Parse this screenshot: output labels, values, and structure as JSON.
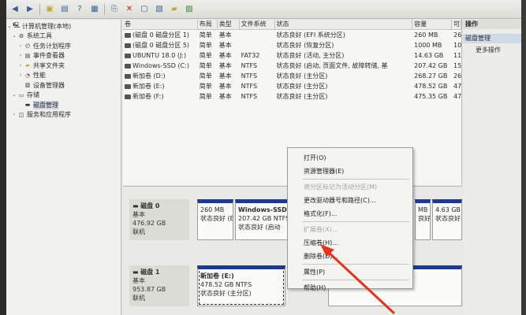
{
  "toolbar": {
    "buttons": [
      "back-icon",
      "forward-icon",
      "up-folder-icon",
      "properties-icon",
      "help-icon",
      "view-icon",
      "connect-icon",
      "delete-icon",
      "new-icon",
      "open-icon",
      "folder-icon",
      "settings-icon"
    ]
  },
  "tree": {
    "items": [
      {
        "label": "计算机管理(本地)",
        "level": 0,
        "icon": "computer-icon",
        "expander": "⌄"
      },
      {
        "label": "系统工具",
        "level": 1,
        "icon": "tools-icon",
        "expander": "⌄"
      },
      {
        "label": "任务计划程序",
        "level": 2,
        "icon": "task-icon",
        "expander": "›"
      },
      {
        "label": "事件查看器",
        "level": 2,
        "icon": "event-icon",
        "expander": "›"
      },
      {
        "label": "共享文件夹",
        "level": 2,
        "icon": "shared-folder-icon",
        "expander": "›"
      },
      {
        "label": "性能",
        "level": 2,
        "icon": "performance-icon",
        "expander": "›"
      },
      {
        "label": "设备管理器",
        "level": 2,
        "icon": "device-icon",
        "expander": ""
      },
      {
        "label": "存储",
        "level": 1,
        "icon": "storage-icon",
        "expander": "⌄"
      },
      {
        "label": "磁盘管理",
        "level": 2,
        "icon": "disk-icon",
        "expander": "",
        "selected": true
      },
      {
        "label": "服务和应用程序",
        "level": 1,
        "icon": "services-icon",
        "expander": "›"
      }
    ]
  },
  "volumes": {
    "headers": [
      "卷",
      "布局",
      "类型",
      "文件系统",
      "状态",
      "容量",
      "可"
    ],
    "rows": [
      [
        "(磁盘 0 磁盘分区 1)",
        "简单",
        "基本",
        "",
        "状态良好 (EFI 系统分区)",
        "260 MB",
        "26"
      ],
      [
        "(磁盘 0 磁盘分区 5)",
        "简单",
        "基本",
        "",
        "状态良好 (恢复分区)",
        "1000 MB",
        "10"
      ],
      [
        "UBUNTU 18.0 (J:)",
        "简单",
        "基本",
        "FAT32",
        "状态良好 (活动, 主分区)",
        "14.63 GB",
        "11"
      ],
      [
        "Windows-SSD (C:)",
        "简单",
        "基本",
        "NTFS",
        "状态良好 (启动, 页面文件, 故障转储, 基",
        "207.42 GB",
        "15"
      ],
      [
        "新加卷 (D:)",
        "简单",
        "基本",
        "NTFS",
        "状态良好 (主分区)",
        "268.27 GB",
        "26"
      ],
      [
        "新加卷 (E:)",
        "简单",
        "基本",
        "NTFS",
        "状态良好 (主分区)",
        "478.52 GB",
        "47"
      ],
      [
        "新加卷 (F:)",
        "简单",
        "基本",
        "NTFS",
        "状态良好 (主分区)",
        "475.35 GB",
        "47"
      ]
    ]
  },
  "disks": [
    {
      "name": "磁盘 0",
      "type": "基本",
      "size": "476.92 GB",
      "status": "联机",
      "parts": [
        {
          "name": "",
          "size": "260 MB",
          "status": "状态良好 (EF"
        },
        {
          "name": "Windows-SSD",
          "size": "207.42 GB NTFS",
          "status": "状态良好 (启动"
        },
        {
          "name": "",
          "size": "MB",
          "status": "良好"
        },
        {
          "name": "",
          "size": "4.63 GB FAT32",
          "status": "状态良好 (活动"
        }
      ]
    },
    {
      "name": "磁盘 1",
      "type": "基本",
      "size": "953.87 GB",
      "status": "联机",
      "parts": [
        {
          "name": "新加卷 (E:)",
          "size": "478.52 GB NTFS",
          "status": "状态良好 (主分区)"
        },
        {
          "name": "",
          "size": "",
          "status": "状态良好 (主分区)"
        }
      ]
    }
  ],
  "actions": {
    "title": "操作",
    "section": "磁盘管理",
    "more": "更多操作"
  },
  "context_menu": {
    "items": [
      {
        "label": "打开(O)",
        "enabled": true
      },
      {
        "label": "资源管理器(E)",
        "enabled": true
      },
      {
        "sep": true
      },
      {
        "label": "将分区标记为活动分区(M)",
        "enabled": false
      },
      {
        "label": "更改驱动器号和路径(C)...",
        "enabled": true
      },
      {
        "label": "格式化(F)...",
        "enabled": true
      },
      {
        "sep": true
      },
      {
        "label": "扩展卷(X)...",
        "enabled": false
      },
      {
        "label": "压缩卷(H)...",
        "enabled": true
      },
      {
        "label": "删除卷(D)...",
        "enabled": true
      },
      {
        "sep": true
      },
      {
        "label": "属性(P)",
        "enabled": true
      },
      {
        "sep": true
      },
      {
        "label": "帮助(H)",
        "enabled": true
      }
    ]
  },
  "colors": {
    "partition_bar": "#1f3b8f",
    "annotation_arrow": "#e8321e"
  }
}
